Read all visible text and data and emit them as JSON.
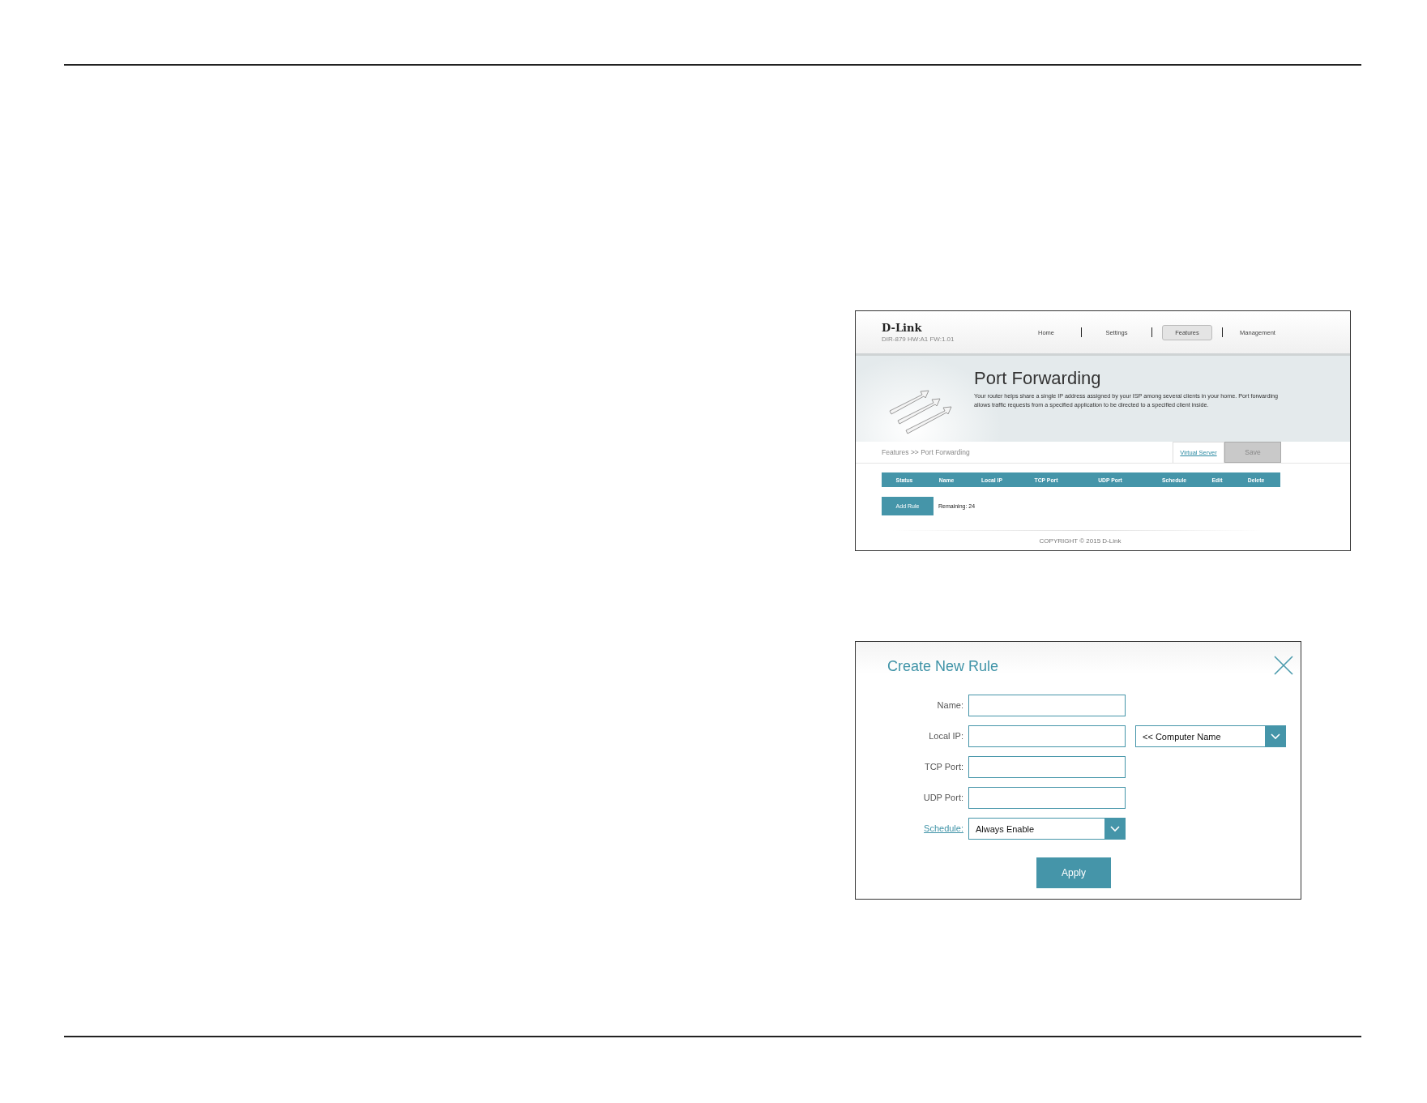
{
  "router_page": {
    "logo": "D-Link",
    "model": "DIR-879 HW:A1 FW:1.01",
    "nav": [
      {
        "label": "Home",
        "selected": false
      },
      {
        "label": "Settings",
        "selected": false
      },
      {
        "label": "Features",
        "selected": true
      },
      {
        "label": "Management",
        "selected": false
      }
    ],
    "title": "Port Forwarding",
    "description": "Your router helps share a single IP address assigned by your ISP among several clients in your home. Port forwarding allows traffic requests from a specified application to be directed to a specified client inside.",
    "breadcrumb": "Features >> Port Forwarding",
    "virtual_server_link": "Virtual Server",
    "save_button": {
      "label": "Save",
      "disabled": true
    },
    "table": {
      "columns": [
        "Status",
        "Name",
        "Local IP",
        "TCP Port",
        "UDP Port",
        "Schedule",
        "Edit",
        "Delete"
      ]
    },
    "add_rule_button": "Add Rule",
    "remaining": "Remaining: 24",
    "copyright": "COPYRIGHT © 2015 D-Link"
  },
  "dialog": {
    "title": "Create New Rule",
    "fields": [
      {
        "label": "Name:",
        "label_link": false,
        "kind": "text"
      },
      {
        "label": "Local IP:",
        "label_link": false,
        "kind": "text"
      },
      {
        "label": "TCP Port:",
        "label_link": false,
        "kind": "text"
      },
      {
        "label": "UDP Port:",
        "label_link": false,
        "kind": "text"
      },
      {
        "label": "Schedule:",
        "label_link": true,
        "kind": "select",
        "value": "Always Enable"
      }
    ],
    "computer_name_select": "<< Computer Name",
    "apply_button": "Apply"
  }
}
